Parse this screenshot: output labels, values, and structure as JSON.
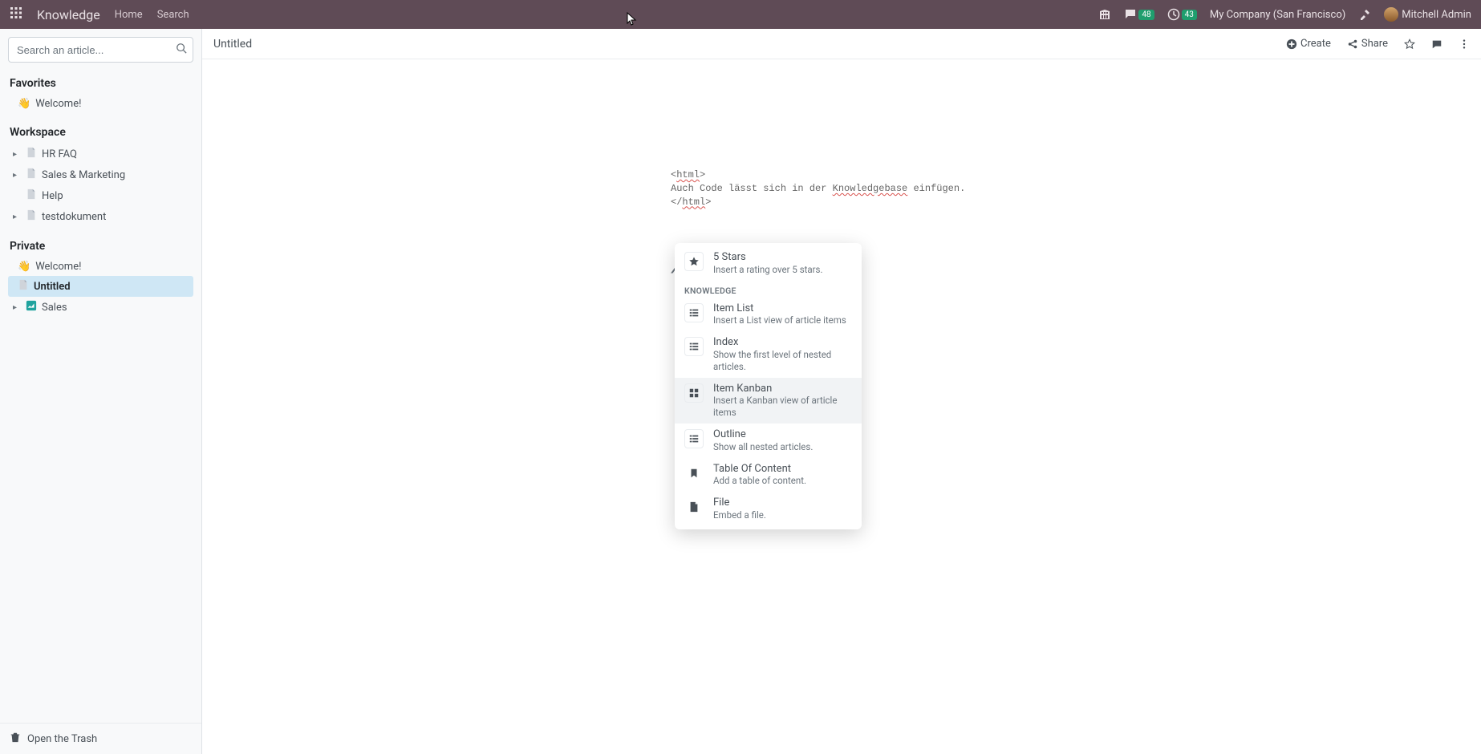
{
  "topbar": {
    "brand": "Knowledge",
    "nav": {
      "home": "Home",
      "search": "Search"
    },
    "badges": {
      "chat": "48",
      "clock": "43"
    },
    "company": "My Company (San Francisco)",
    "user": "Mitchell Admin"
  },
  "sidebar": {
    "search_placeholder": "Search an article...",
    "sections": {
      "favorites": {
        "title": "Favorites",
        "items": [
          {
            "emoji": "👋",
            "label": "Welcome!"
          }
        ]
      },
      "workspace": {
        "title": "Workspace",
        "items": [
          {
            "label": "HR FAQ",
            "has_caret": true
          },
          {
            "label": "Sales & Marketing",
            "has_caret": true
          },
          {
            "label": "Help",
            "has_caret": false
          },
          {
            "label": "testdokument",
            "has_caret": true
          }
        ]
      },
      "private": {
        "title": "Private",
        "items": [
          {
            "emoji": "👋",
            "label": "Welcome!"
          },
          {
            "label": "Untitled",
            "active": true
          },
          {
            "label": "Sales",
            "has_caret": true,
            "icon_variant": "teal"
          }
        ]
      }
    },
    "trash": "Open the Trash"
  },
  "main": {
    "breadcrumb": "Untitled",
    "actions": {
      "create": "Create",
      "share": "Share"
    },
    "code": {
      "l1_a": "<",
      "l1_b": "html",
      "l1_c": ">",
      "l2_a": "Auch Code lässt sich in der ",
      "l2_b": "Knowledgebase",
      "l2_c": " einfügen.",
      "l3_a": "</",
      "l3_b": "html",
      "l3_c": ">"
    },
    "slash": "/"
  },
  "popup": {
    "five_stars": {
      "title": "5 Stars",
      "desc": "Insert a rating over 5 stars."
    },
    "group_label": "KNOWLEDGE",
    "item_list": {
      "title": "Item List",
      "desc": "Insert a List view of article items"
    },
    "index": {
      "title": "Index",
      "desc": "Show the first level of nested articles."
    },
    "item_kanban": {
      "title": "Item Kanban",
      "desc": "Insert a Kanban view of article items"
    },
    "outline": {
      "title": "Outline",
      "desc": "Show all nested articles."
    },
    "toc": {
      "title": "Table Of Content",
      "desc": "Add a table of content."
    },
    "file": {
      "title": "File",
      "desc": "Embed a file."
    }
  }
}
